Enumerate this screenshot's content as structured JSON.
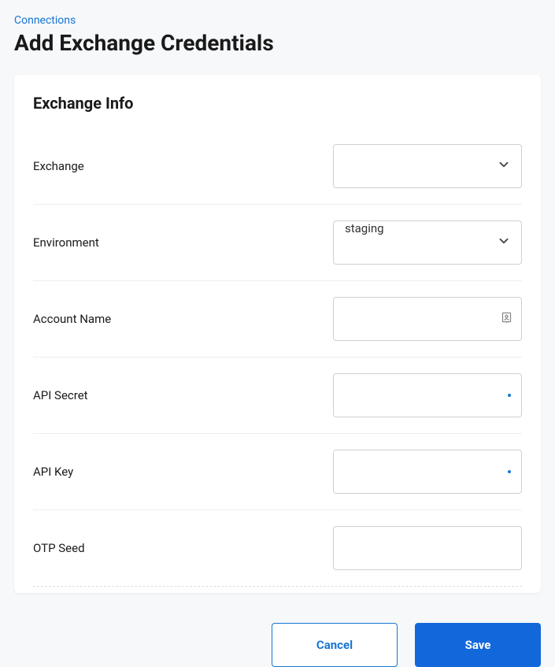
{
  "breadcrumb": "Connections",
  "page_title": "Add Exchange Credentials",
  "card": {
    "title": "Exchange Info",
    "fields": {
      "exchange": {
        "label": "Exchange",
        "value": ""
      },
      "environment": {
        "label": "Environment",
        "value": "staging"
      },
      "account_name": {
        "label": "Account Name",
        "value": ""
      },
      "api_secret": {
        "label": "API Secret",
        "value": ""
      },
      "api_key": {
        "label": "API Key",
        "value": ""
      },
      "otp_seed": {
        "label": "OTP Seed",
        "value": ""
      }
    }
  },
  "buttons": {
    "cancel": "Cancel",
    "save": "Save"
  }
}
